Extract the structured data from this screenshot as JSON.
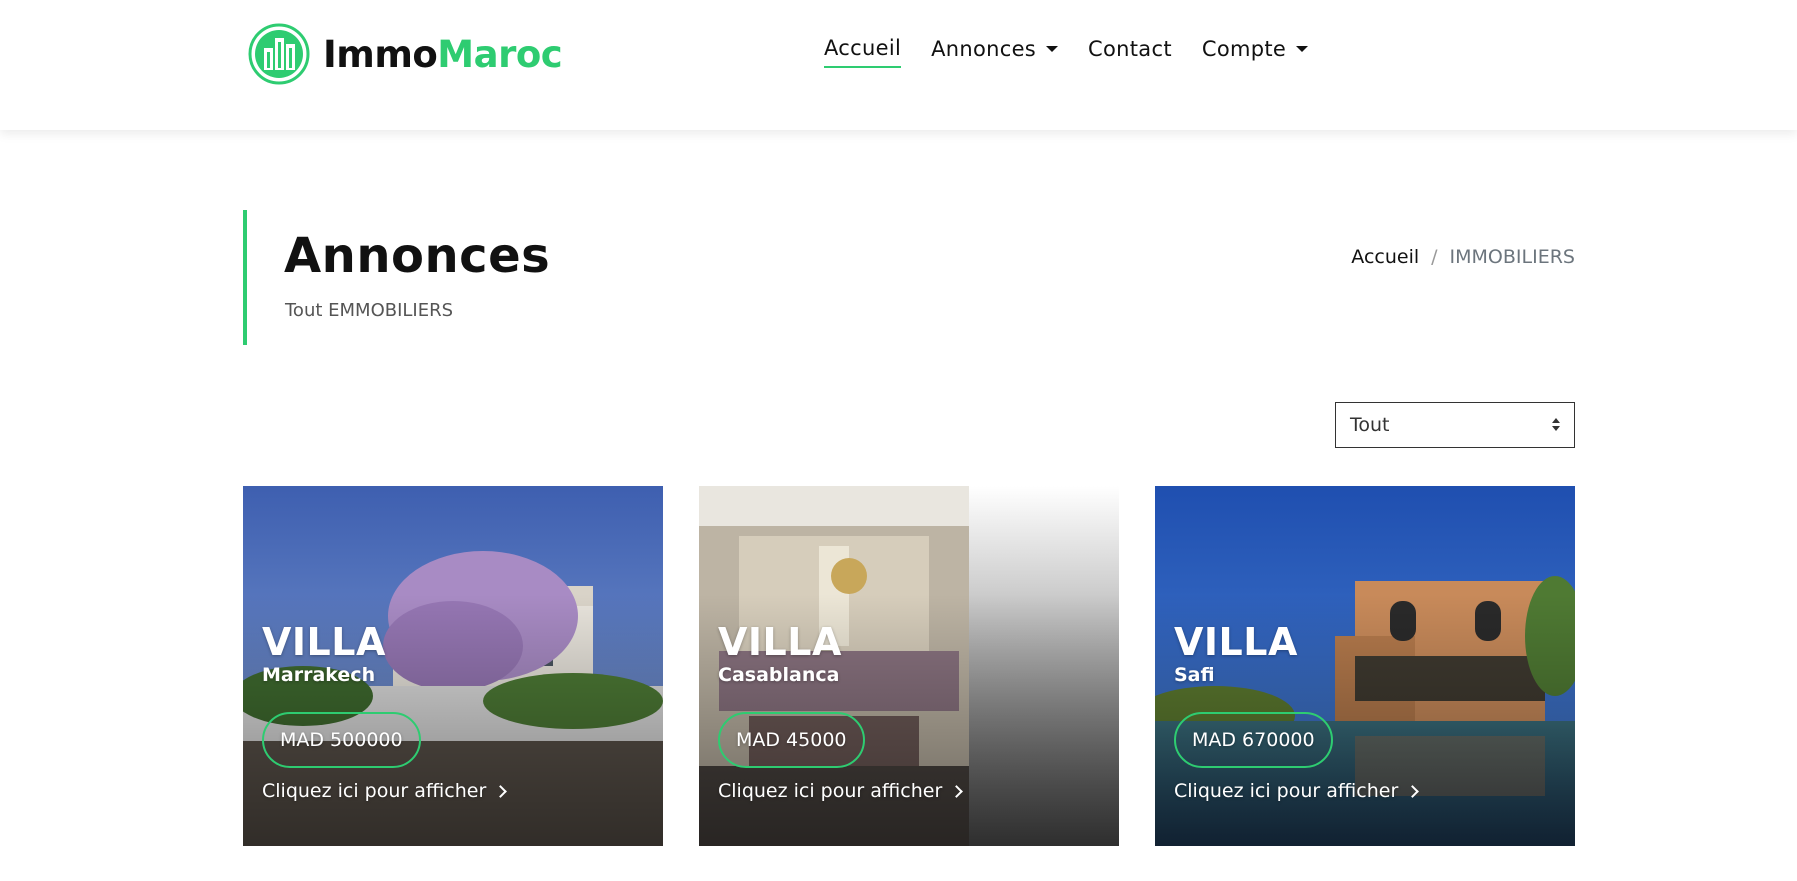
{
  "brand": {
    "part1": "Immo",
    "part2": "Maroc",
    "accent": "#2ecc71"
  },
  "nav": {
    "items": [
      {
        "label": "Accueil",
        "active": true,
        "dropdown": false
      },
      {
        "label": "Annonces",
        "active": false,
        "dropdown": true
      },
      {
        "label": "Contact",
        "active": false,
        "dropdown": false
      },
      {
        "label": "Compte",
        "active": false,
        "dropdown": true
      }
    ]
  },
  "page": {
    "title": "Annonces",
    "subtitle": "Tout EMMOBILIERS"
  },
  "breadcrumb": {
    "home": "Accueil",
    "separator": "/",
    "current": "IMMOBILIERS"
  },
  "filter": {
    "selected": "Tout"
  },
  "listings": [
    {
      "type": "VILLA",
      "city": "Marrakech",
      "price": "MAD 500000",
      "link": "Cliquez ici pour afficher"
    },
    {
      "type": "VILLA",
      "city": "Casablanca",
      "price": "MAD 45000",
      "link": "Cliquez ici pour afficher"
    },
    {
      "type": "VILLA",
      "city": "Safi",
      "price": "MAD 670000",
      "link": "Cliquez ici pour afficher"
    }
  ]
}
